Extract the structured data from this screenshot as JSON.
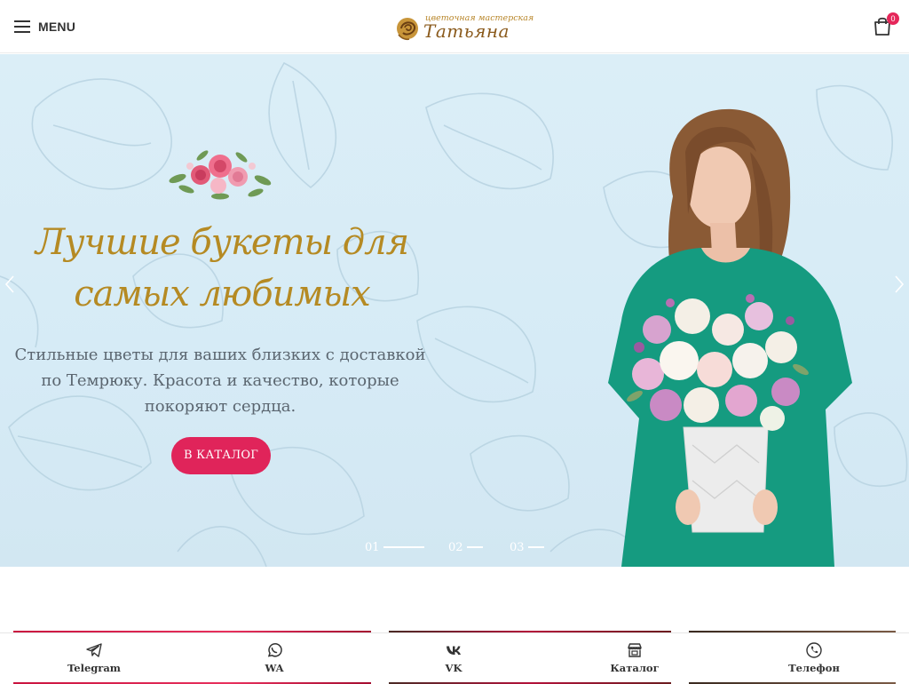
{
  "header": {
    "menu_label": "MENU",
    "logo_small": "цветочная мастерская",
    "logo_big": "Татьяна",
    "cart_count": "0"
  },
  "hero": {
    "title": "Лучшие букеты для самых любимых",
    "subtitle": "Стильные цветы для ваших близких с доставкой по Темрюку. Красота и качество, которые покоряют сердца.",
    "cta_label": "В КАТАЛОГ",
    "slides": [
      {
        "label": "01",
        "active": true
      },
      {
        "label": "02",
        "active": false
      },
      {
        "label": "03",
        "active": false
      }
    ]
  },
  "bottom_nav": {
    "items": [
      {
        "label": "Telegram",
        "icon": "telegram-icon"
      },
      {
        "label": "WA",
        "icon": "whatsapp-icon"
      },
      {
        "label": "VK",
        "icon": "vk-icon"
      },
      {
        "label": "Каталог",
        "icon": "store-icon"
      },
      {
        "label": "Телефон",
        "icon": "phone-icon"
      }
    ]
  },
  "colors": {
    "accent": "#e0245a",
    "title_gold": "#b58a23",
    "hero_bg": "#d6ebf6",
    "dress_green": "#159b80"
  }
}
